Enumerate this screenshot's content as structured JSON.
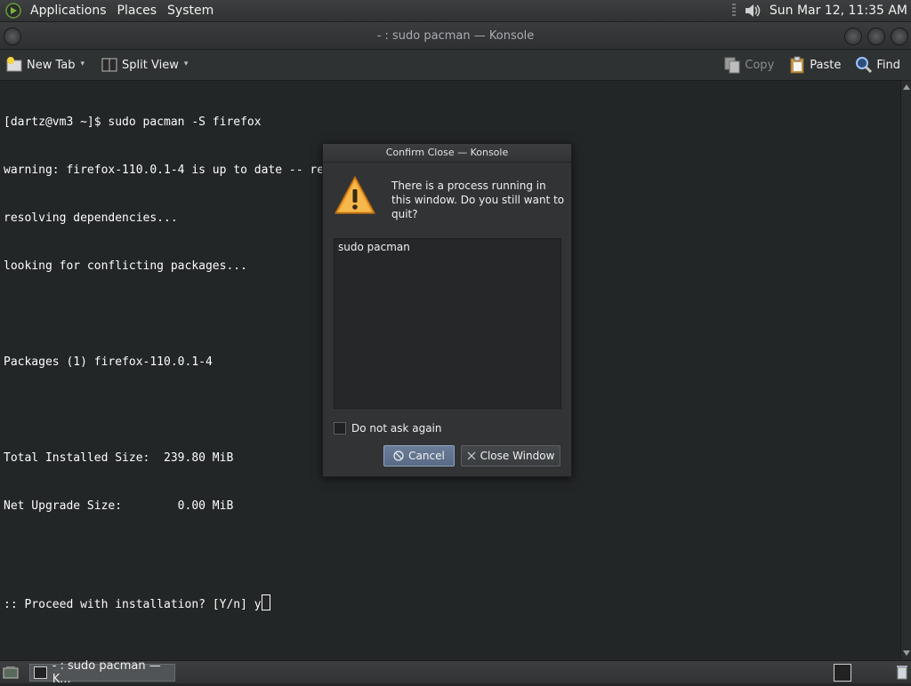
{
  "top_panel": {
    "menus": [
      "Applications",
      "Places",
      "System"
    ],
    "clock": "Sun Mar 12, 11:35 AM"
  },
  "window": {
    "title": "- : sudo pacman — Konsole"
  },
  "toolbar": {
    "new_tab": "New Tab",
    "split_view": "Split View",
    "copy": "Copy",
    "paste": "Paste",
    "find": "Find"
  },
  "terminal": {
    "lines": [
      "[dartz@vm3 ~]$ sudo pacman -S firefox",
      "warning: firefox-110.0.1-4 is up to date -- reinstalling",
      "resolving dependencies...",
      "looking for conflicting packages...",
      "",
      "Packages (1) firefox-110.0.1-4",
      "",
      "Total Installed Size:  239.80 MiB",
      "Net Upgrade Size:        0.00 MiB",
      "",
      ":: Proceed with installation? [Y/n] y"
    ]
  },
  "dialog": {
    "title": "Confirm Close — Konsole",
    "message": "There is a process running in this window. Do you still want to quit?",
    "processes": [
      "sudo pacman"
    ],
    "dont_ask_label": "Do not ask again",
    "cancel": "Cancel",
    "close_window": "Close Window"
  },
  "taskbar": {
    "task_label": "- : sudo pacman — K..."
  },
  "colors": {
    "terminal_bg": "#232627",
    "accent": "#6a7d98"
  }
}
